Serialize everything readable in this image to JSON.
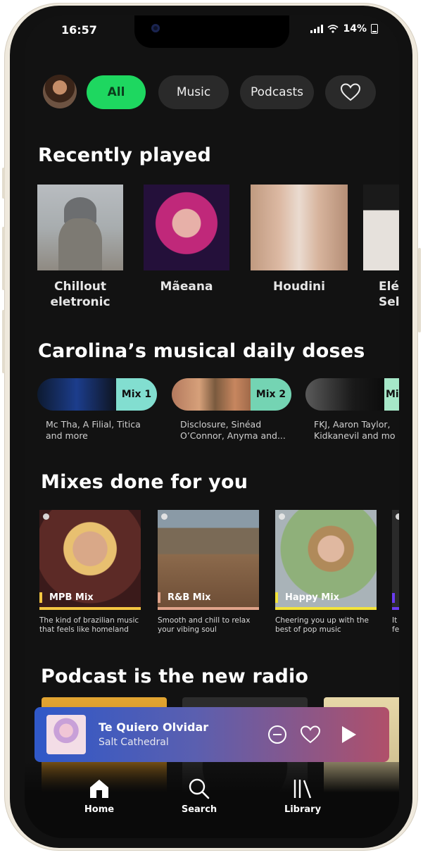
{
  "status_bar": {
    "time": "16:57",
    "battery": "14%"
  },
  "filters": [
    {
      "label": "All",
      "active": true
    },
    {
      "label": "Music",
      "active": false
    },
    {
      "label": "Podcasts",
      "active": false
    }
  ],
  "sections": {
    "recently_played": "Recently played",
    "daily_doses": "Carolina’s musical daily doses",
    "mixes": "Mixes done for you",
    "podcasts": "Podcast is the new radio"
  },
  "recently_played": [
    {
      "label": "Chillout\neletronic"
    },
    {
      "label": "Mãeana"
    },
    {
      "label": "Houdini"
    },
    {
      "label": "Elé\nSelv"
    }
  ],
  "daily_doses": [
    {
      "tag": "Mix 1",
      "desc": "Mc Tha, A Filial, Titica\nand more",
      "color": "#82ded0"
    },
    {
      "tag": "Mix 2",
      "desc": "Disclosure, Sinéad\nO’Connor, Anyma and...",
      "color": "#74d4b3"
    },
    {
      "tag": "Mi",
      "desc": "FKJ, Aaron Taylor,\nKidkanevil and mo",
      "color": "#a6e7c8"
    }
  ],
  "mixes": [
    {
      "label": "MPB Mix",
      "desc": "The kind of brazilian music\nthat feels like homeland",
      "color": "#f5c642"
    },
    {
      "label": "R&B Mix",
      "desc": "Smooth and chill to relax\nyour vibing soul",
      "color": "#e0a38a"
    },
    {
      "label": "Happy Mix",
      "desc": "Cheering you up with the\nbest of pop music",
      "color": "#f3e43a"
    },
    {
      "label": "",
      "desc": "It\nfe",
      "color": "#6a3cf0"
    }
  ],
  "now_playing": {
    "title": "Te Quiero Olvidar",
    "artist": "Salt Cathedral"
  },
  "tabs": [
    {
      "label": "Home",
      "icon": "home-icon"
    },
    {
      "label": "Search",
      "icon": "search-icon"
    },
    {
      "label": "Library",
      "icon": "library-icon"
    }
  ],
  "colors": {
    "accent": "#1ed760",
    "background": "#121212"
  }
}
